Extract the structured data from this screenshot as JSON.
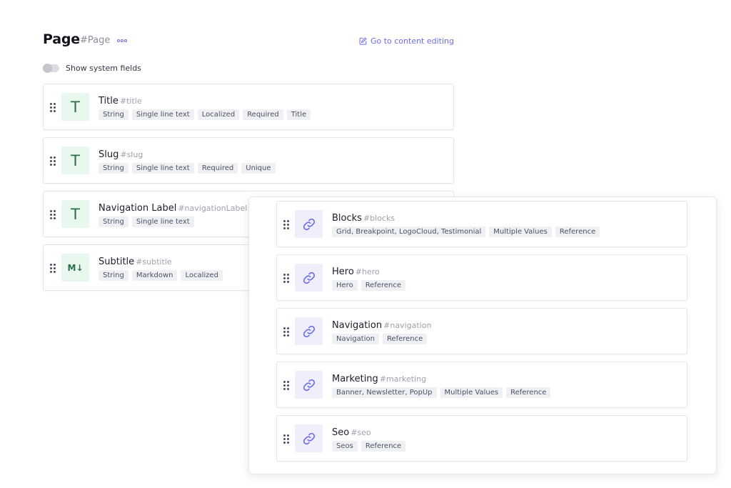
{
  "header": {
    "title": "Page",
    "api_id": "#Page",
    "more_icon": "ellipsis-icon",
    "goto_label": "Go to content editing",
    "goto_icon": "edit-icon"
  },
  "system_fields": {
    "label": "Show system fields",
    "enabled": false
  },
  "fields": [
    {
      "name": "Title",
      "api_id": "#title",
      "icon": "T",
      "icon_type": "string",
      "tags": [
        "String",
        "Single line text",
        "Localized",
        "Required",
        "Title"
      ]
    },
    {
      "name": "Slug",
      "api_id": "#slug",
      "icon": "T",
      "icon_type": "string",
      "tags": [
        "String",
        "Single line text",
        "Required",
        "Unique"
      ]
    },
    {
      "name": "Navigation Label",
      "api_id": "#navigationLabel",
      "icon": "T",
      "icon_type": "string",
      "tags": [
        "String",
        "Single line text"
      ]
    },
    {
      "name": "Subtitle",
      "api_id": "#subtitle",
      "icon": "M↓",
      "icon_type": "markdown",
      "tags": [
        "String",
        "Markdown",
        "Localized"
      ]
    }
  ],
  "reference_fields": [
    {
      "name": "Blocks",
      "api_id": "#blocks",
      "icon": "link-icon",
      "tags": [
        "Grid, Breakpoint, LogoCloud, Testimonial",
        "Multiple Values",
        "Reference"
      ]
    },
    {
      "name": "Hero",
      "api_id": "#hero",
      "icon": "link-icon",
      "tags": [
        "Hero",
        "Reference"
      ]
    },
    {
      "name": "Navigation",
      "api_id": "#navigation",
      "icon": "link-icon",
      "tags": [
        "Navigation",
        "Reference"
      ]
    },
    {
      "name": "Marketing",
      "api_id": "#marketing",
      "icon": "link-icon",
      "tags": [
        "Banner, Newsletter, PopUp",
        "Multiple Values",
        "Reference"
      ]
    },
    {
      "name": "Seo",
      "api_id": "#seo",
      "icon": "link-icon",
      "tags": [
        "Seos",
        "Reference"
      ]
    }
  ],
  "colors": {
    "accent": "#6b6cf0",
    "string_icon_bg": "#e9f8ee",
    "reference_icon_bg": "#f0eefb",
    "tag_bg": "#eef0f4"
  }
}
